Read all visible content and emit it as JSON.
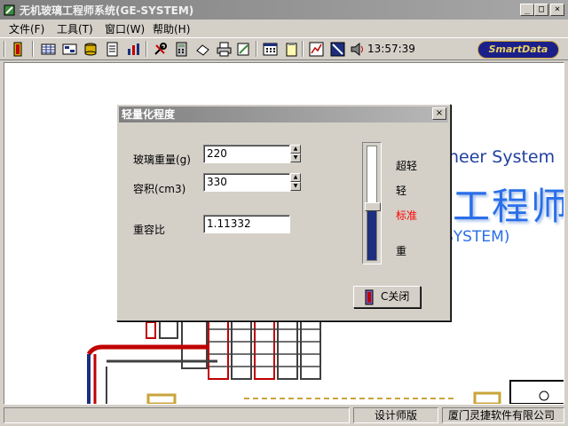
{
  "window": {
    "title": "无机玻璃工程师系统(GE-SYSTEM)",
    "minimize": "_",
    "maximize": "□",
    "close": "×"
  },
  "menu": [
    {
      "label": "文件(F)"
    },
    {
      "label": "工具(T)"
    },
    {
      "label": "窗口(W)"
    },
    {
      "label": "帮助(H)"
    }
  ],
  "toolbar": {
    "clock": "13:57:39",
    "logo_text": "SmartData"
  },
  "background": {
    "english_line": "neer System",
    "chinese_line": "工程师",
    "system_line": "SYSTEM)"
  },
  "dialog": {
    "title": "轻量化程度",
    "close": "×",
    "fields": {
      "glass_weight": {
        "label": "玻璃重量(g)",
        "value": "220"
      },
      "volume": {
        "label": "容积(cm3)",
        "value": "330"
      },
      "ratio": {
        "label": "重容比",
        "value": "1.11332"
      }
    },
    "levels": [
      {
        "label": "超轻",
        "color": "#000000"
      },
      {
        "label": "轻",
        "color": "#000000"
      },
      {
        "label": "标准",
        "color": "#ff0000"
      },
      {
        "label": "重",
        "color": "#000000"
      }
    ],
    "slider_fraction": 0.47,
    "close_button": "C关闭"
  },
  "status": {
    "pane1": "",
    "pane2": "设计师版",
    "pane3": "厦门灵捷软件有限公司"
  }
}
